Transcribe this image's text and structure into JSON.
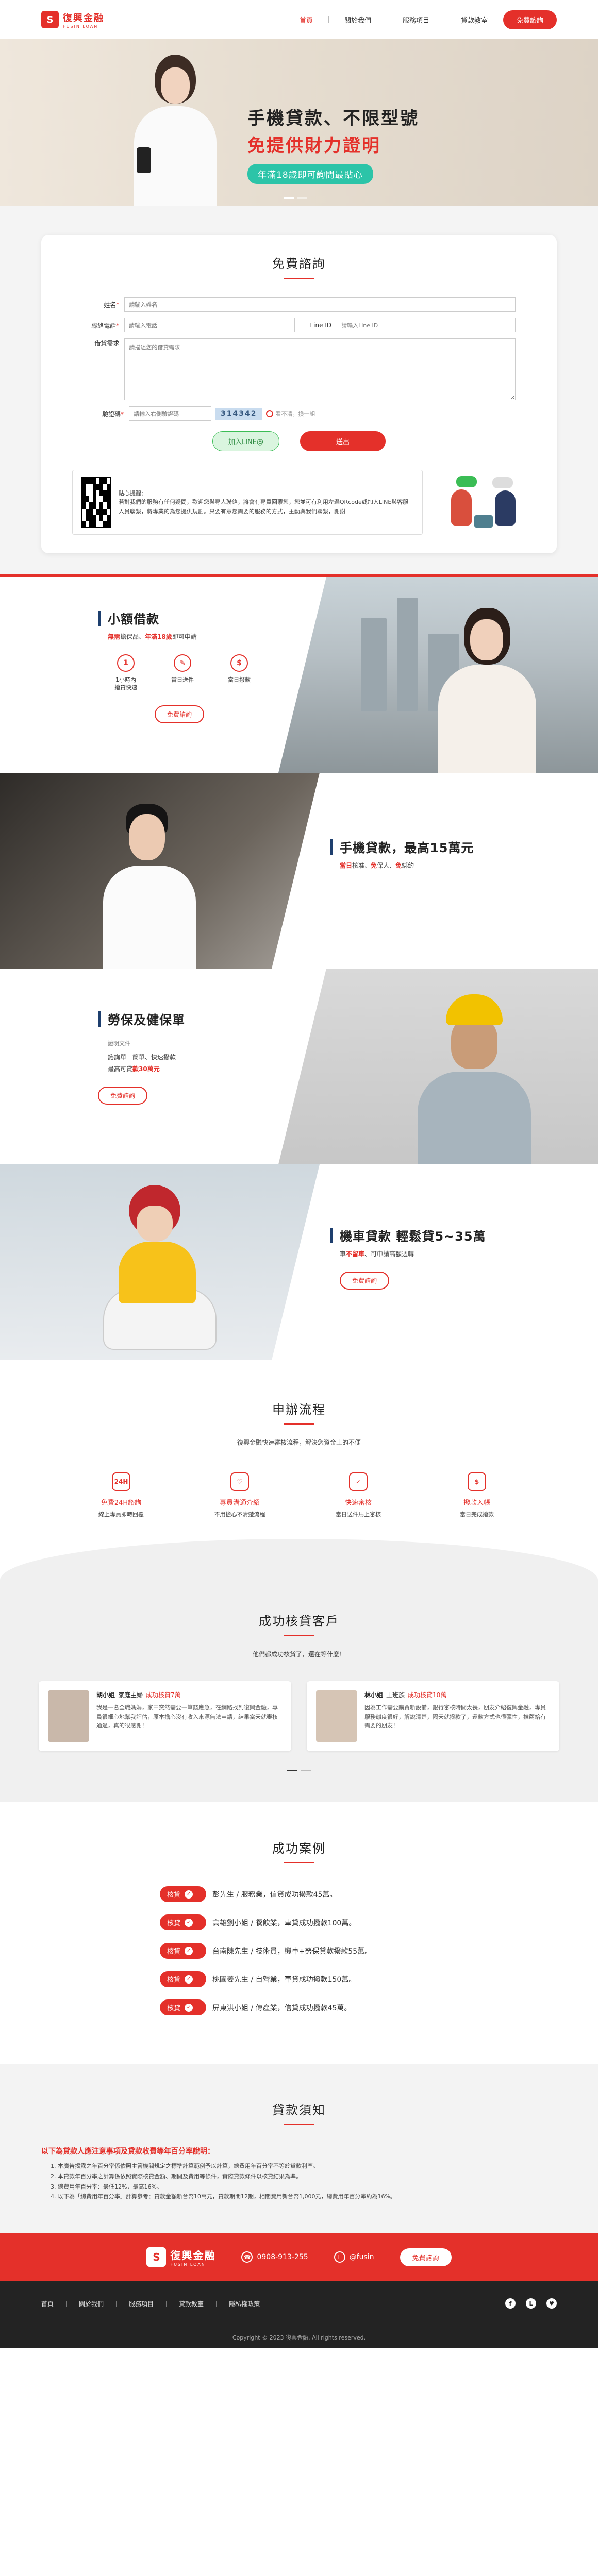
{
  "brand": {
    "name": "復興金融",
    "sub": "FUSIN LOAN",
    "mark": "S"
  },
  "nav": {
    "items": [
      "首頁",
      "關於我們",
      "服務項目",
      "貸款教室"
    ],
    "cta": "免費諮詢"
  },
  "hero": {
    "line1": "手機貸款、不限型號",
    "line2": "免提供財力證明",
    "pill": "年滿18歲即可詢問最貼心"
  },
  "form": {
    "title": "免費諮詢",
    "name_label": "姓名",
    "name_ph": "請輸入姓名",
    "phone_label": "聯絡電話",
    "phone_ph": "請輸入電話",
    "line_label": "Line ID",
    "line_ph": "請輸入Line ID",
    "need_label": "借貸需求",
    "need_ph": "請描述您的借貸需求",
    "code_label": "驗證碼",
    "code_ph": "請輸入右側驗證碼",
    "code_value": "314342",
    "refresh": "看不清，換一組",
    "line_btn": "加入LINE@",
    "send_btn": "送出",
    "qr_text": "貼心提醒：\n若對我們的服務有任何疑問，歡迎您與專人聯絡，將會有專員回覆您，您並可有利用左邊QRcode或加入LINE與客服人員聯繫，將專業的為您提供規劃。只要有意您需要的服務的方式，主動與我們聯繫，謝謝"
  },
  "feature1": {
    "title": "小額借款",
    "sub_pre": "",
    "sub_hl1": "無需",
    "sub_mid": "擔保品、",
    "sub_hl2": "年滿18歲",
    "sub_post": "即可申請",
    "icons": [
      {
        "label": "1小時內\n撥貸快速",
        "glyph": "1"
      },
      {
        "label": "當日送件",
        "glyph": "✎"
      },
      {
        "label": "當日撥款",
        "glyph": "$"
      }
    ],
    "btn": "免費諮詢"
  },
  "feature2": {
    "title": "手機貸款，最高15萬元",
    "sub_hl1": "當日",
    "sub_mid": "核准、",
    "sub_hl2": "免",
    "sub_mid2": "保人、",
    "sub_hl3": "免",
    "sub_post": "綁約",
    "btn": "免費諮詢"
  },
  "feature3": {
    "title": "勞保及健保單",
    "small": "證明文件",
    "line1": "諮詢單一簡單、快速撥款",
    "line2": "最高可貸",
    "hl": "款",
    "amount": "30萬元",
    "btn": "免費諮詢"
  },
  "feature4": {
    "title": "機車貸款 輕鬆貸5~35萬",
    "sub_pre": "車",
    "sub_hl": "不留車",
    "sub_post": "、可申請高額週轉",
    "btn": "免費諮詢"
  },
  "flow": {
    "title": "申辦流程",
    "sub": "復興金融快速審核流程，解決您資金上的不便",
    "steps": [
      {
        "icon": "24H",
        "title": "免費24H諮詢",
        "desc": "線上專員即時回覆"
      },
      {
        "icon": "♡",
        "title": "專員溝通介紹",
        "desc": "不用擔心不清楚流程"
      },
      {
        "icon": "✓",
        "title": "快速審核",
        "desc": "當日送件馬上審核"
      },
      {
        "icon": "$",
        "title": "撥款入帳",
        "desc": "當日完成撥款"
      }
    ]
  },
  "cases": {
    "title": "成功核貸客戶",
    "sub": "他們都成功核貸了，還在等什麼！",
    "items": [
      {
        "name": "胡小姐",
        "role": "家庭主婦",
        "tag": "成功核貸7萬",
        "text": "我是一名全職媽媽，家中突然需要一筆錢應急，在網路找到復興金融，專員很細心地幫我評估，原本擔心沒有收入來源無法申請，結果當天就審核通過，真的很感謝！"
      },
      {
        "name": "林小姐",
        "role": "上班族",
        "tag": "成功核貸10萬",
        "text": "因為工作需要購買新設備，銀行審核時間太長，朋友介紹復興金融，專員服務態度很好，解說清楚，隔天就撥款了，還款方式也很彈性，推薦給有需要的朋友！"
      }
    ]
  },
  "success": {
    "title": "成功案例",
    "badge": "核貸",
    "items": [
      "彭先生 / 服務業，信貸成功撥款45萬。",
      "高雄劉小姐 / 餐飲業，車貸成功撥款100萬。",
      "台南陳先生 / 技術員，機車+勞保貸款撥款55萬。",
      "桃園姜先生 / 自營業，車貸成功撥款150萬。",
      "屏東洪小姐 / 傳產業，信貸成功撥款45萬。"
    ]
  },
  "notice": {
    "title": "貸款須知",
    "head": "以下為貸款人應注意事項及貸款收費等年百分率說明：",
    "items": [
      "1. 本廣告揭露之年百分率係依照主管機關規定之標準計算範例予以計算，總費用年百分率不等於貸款利率。",
      "2. 本貸款年百分率之計算係依照實際核貸金額、期間及費用等條件，實際貸款條件以核貸結果為準。",
      "3. 總費用年百分率：最低12%，最高16%。",
      "4. 以下為「總費用年百分率」計算參考：貸款金額新台幣10萬元，貸款期間12期，相關費用新台幣1,000元，總費用年百分率約為16%。"
    ]
  },
  "footer": {
    "phone": "0908-913-255",
    "line": "@fusin",
    "cta": "免費諮詢",
    "nav": [
      "首頁",
      "關於我們",
      "服務項目",
      "貸款教室",
      "隱私權政策"
    ],
    "social": [
      "f",
      "L",
      "♥"
    ],
    "copyright": "Copyright © 2023 復興金融. All rights reserved."
  },
  "colors": {
    "brand": "#e4302a",
    "accent": "#2cc4a8",
    "navy": "#1e3f6e"
  }
}
